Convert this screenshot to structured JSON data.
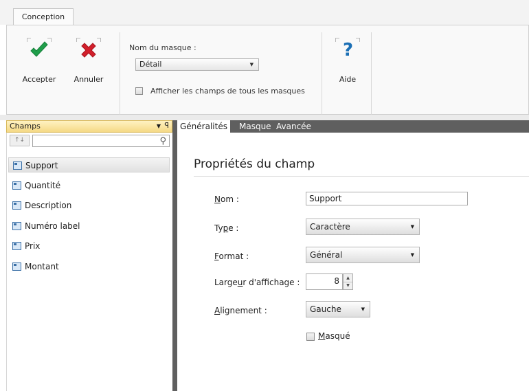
{
  "ribbon": {
    "tab": "Conception",
    "accept_label": "Accepter",
    "cancel_label": "Annuler",
    "mask_name_label": "Nom du masque :",
    "mask_value": "Détail",
    "show_all_masks_label": "Afficher les champs de tous les masques",
    "show_all_masks_checked": false,
    "help_label": "Aide"
  },
  "fields_pane": {
    "title": "Champs",
    "sort_label": "↑↓",
    "items": [
      {
        "label": "Support",
        "selected": true
      },
      {
        "label": "Quantité",
        "selected": false
      },
      {
        "label": "Description",
        "selected": false
      },
      {
        "label": "Numéro label",
        "selected": false
      },
      {
        "label": "Prix",
        "selected": false
      },
      {
        "label": "Montant",
        "selected": false
      }
    ]
  },
  "props": {
    "tabs": [
      {
        "label": "Généralités",
        "active": true
      },
      {
        "label": "Masque",
        "active": false
      },
      {
        "label": "Avancée",
        "active": false
      }
    ],
    "title": "Propriétés du champ",
    "name": {
      "label_ul": "N",
      "label_rest": "om :",
      "value": "Support"
    },
    "type": {
      "label_pre": "Ty",
      "label_ul": "p",
      "label_rest": "e :",
      "value": "Caractère"
    },
    "format": {
      "label_ul": "F",
      "label_rest": "ormat :",
      "value": "Général"
    },
    "width": {
      "label_pre": "Large",
      "label_ul": "u",
      "label_rest": "r d'affichage :",
      "value": "8"
    },
    "alignment": {
      "label_ul": "A",
      "label_rest": "lignement :",
      "value": "Gauche"
    },
    "hidden": {
      "label_ul": "M",
      "label_rest": "asqué",
      "checked": false
    }
  },
  "colors": {
    "accept": "#1f9e4a",
    "cancel": "#d21f2b",
    "help": "#1b6fb5",
    "pane_header": "#f5d985",
    "dark_strip": "#5f5f5f"
  }
}
